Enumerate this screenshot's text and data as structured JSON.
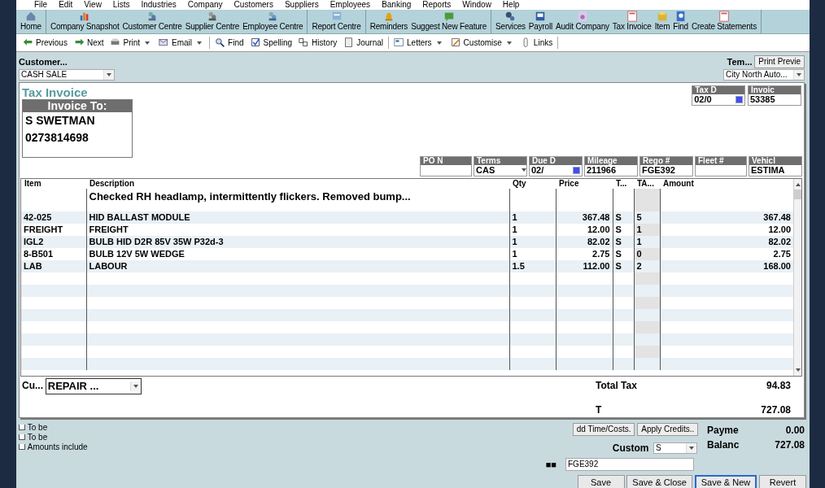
{
  "menu": [
    "File",
    "Edit",
    "View",
    "Lists",
    "Industries",
    "Company",
    "Customers",
    "Suppliers",
    "Employees",
    "Banking",
    "Reports",
    "Window",
    "Help"
  ],
  "toolbar_groups": [
    [
      "Home"
    ],
    [
      "Company Snapshot",
      "Customer Centre",
      "Supplier Centre",
      "Employee Centre"
    ],
    [
      "Report Centre"
    ],
    [
      "Reminders",
      "Suggest New Feature"
    ],
    [
      "Services",
      "Payroll",
      "Audit Company",
      "Tax Invoice",
      "Item",
      "Find",
      "Create Statements"
    ]
  ],
  "nav_groups": [
    [
      {
        "label": "Previous",
        "dropdown": false
      },
      {
        "label": "Next",
        "dropdown": false
      },
      {
        "label": "Print",
        "dropdown": true
      },
      {
        "label": "Email",
        "dropdown": true
      }
    ],
    [
      {
        "label": "Find",
        "dropdown": false
      },
      {
        "label": "Spelling",
        "dropdown": false
      },
      {
        "label": "History",
        "dropdown": false
      },
      {
        "label": "Journal",
        "dropdown": false
      }
    ],
    [
      {
        "label": "Letters",
        "dropdown": true
      },
      {
        "label": "Customise",
        "dropdown": true
      },
      {
        "label": "Links",
        "dropdown": false
      }
    ]
  ],
  "customer": {
    "label": "Customer...",
    "value": "CASH SALE"
  },
  "template": {
    "label": "Tem...",
    "button": "Print Previe",
    "value": "City North Auto..."
  },
  "title": "Tax Invoice",
  "invoice_to": {
    "heading": "Invoice To:",
    "lines": [
      "S SWETMAN",
      "0273814698"
    ]
  },
  "header_fields": [
    {
      "label": "Tax D",
      "value": "02/0",
      "kind": "date"
    },
    {
      "label": "Invoic",
      "value": "53385",
      "kind": "text"
    }
  ],
  "detail_fields": [
    {
      "label": "PO N",
      "kind": "text"
    },
    {
      "label": "Terms",
      "value": "CAS",
      "kind": "select"
    },
    {
      "label": "Due D",
      "value": "02/",
      "kind": "date"
    },
    {
      "label": "Mileage",
      "value": "211966",
      "kind": "text"
    },
    {
      "label": "Rego #",
      "value": "FGE392",
      "kind": "text"
    },
    {
      "label": "Fleet #",
      "kind": "text"
    },
    {
      "label": "Vehicl",
      "value": "ESTIMA",
      "kind": "text"
    }
  ],
  "table": {
    "columns": [
      "Item",
      "Description",
      "Qty",
      "Price",
      "T...",
      "TA...",
      "Amount"
    ],
    "rows": [
      {
        "description": "Checked RH headlamp, intermittently flickers. Removed bump..."
      },
      {
        "item": "42-025",
        "description": "HID BALLAST MODULE",
        "qty": "1",
        "price": "367.48",
        "tax": "S",
        "ta": "5",
        "amount": "367.48"
      },
      {
        "item": "FREIGHT",
        "description": "FREIGHT",
        "qty": "1",
        "price": "12.00",
        "tax": "S",
        "ta": "1",
        "amount": "12.00"
      },
      {
        "item": "IGL2",
        "description": "BULB HID D2R 85V 35W P32d-3",
        "qty": "1",
        "price": "82.02",
        "tax": "S",
        "ta": "1",
        "amount": "82.02"
      },
      {
        "item": "8-B501",
        "description": "BULB 12V 5W WEDGE",
        "qty": "1",
        "price": "2.75",
        "tax": "S",
        "ta": "0",
        "amount": "2.75"
      },
      {
        "item": "LAB",
        "description": "LABOUR",
        "qty": "1.5",
        "price": "112.00",
        "tax": "S",
        "ta": "2",
        "amount": "168.00"
      }
    ]
  },
  "comment": {
    "label": "Cu...",
    "value": "REPAIR ..."
  },
  "totals": [
    {
      "label": "Total Tax",
      "value": "94.83"
    },
    {
      "label": "T",
      "value": "727.08"
    }
  ],
  "checkboxes": [
    {
      "label": "To be",
      "checked": false
    },
    {
      "label": "To be",
      "checked": false
    },
    {
      "label": "Amounts include",
      "checked": false
    }
  ],
  "action_buttons": [
    "dd Time/Costs.",
    "Apply Credits.."
  ],
  "balances": [
    {
      "label": "Payme",
      "value": "0.00"
    },
    {
      "label": "Balanc",
      "value": "727.08"
    }
  ],
  "custom": {
    "label": "Custom",
    "value": "S"
  },
  "rego_field": {
    "label": "■■",
    "value": "FGE392"
  },
  "footer_buttons": [
    {
      "label": "Save",
      "default": false
    },
    {
      "label": "Save & Close",
      "default": false
    },
    {
      "label": "Save & New",
      "default": true
    },
    {
      "label": "Revert",
      "default": false
    }
  ]
}
